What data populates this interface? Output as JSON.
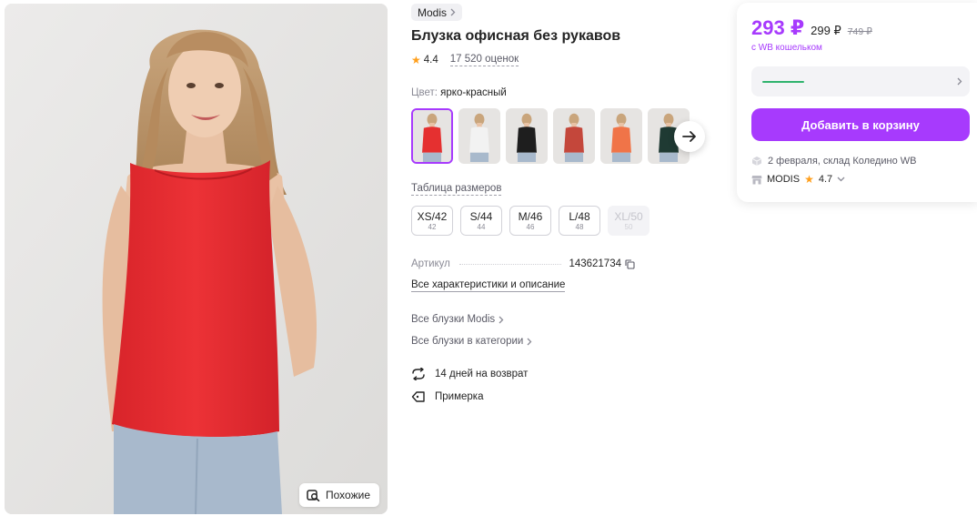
{
  "gallery": {
    "similar_label": "Похожие"
  },
  "product": {
    "brand": "Modis",
    "title": "Блузка офисная без рукавов",
    "rating": "4.4",
    "reviews": "17 520 оценок",
    "color_label": "Цвет:",
    "color_value": "ярко-красный",
    "thumbnails": [
      {
        "color": "#e53030",
        "selected": true
      },
      {
        "color": "#f2f2f2",
        "selected": false
      },
      {
        "color": "#1e1e1e",
        "selected": false
      },
      {
        "color": "#c4473b",
        "selected": false
      },
      {
        "color": "#f07448",
        "selected": false
      },
      {
        "color": "#1f3a33",
        "selected": false
      }
    ],
    "size_table_link": "Таблица размеров",
    "sizes": [
      {
        "label": "XS/42",
        "ru": "42",
        "available": true
      },
      {
        "label": "S/44",
        "ru": "44",
        "available": true
      },
      {
        "label": "M/46",
        "ru": "46",
        "available": true
      },
      {
        "label": "L/48",
        "ru": "48",
        "available": true
      },
      {
        "label": "XL/50",
        "ru": "50",
        "available": false
      }
    ],
    "sku_label": "Артикул",
    "sku_value": "143621734",
    "all_characteristics": "Все характеристики и описание",
    "links": {
      "brand_category": "Все блузки Modis",
      "category": "Все блузки в категории"
    },
    "features": {
      "returns": "14 дней на возврат",
      "fitting": "Примерка"
    }
  },
  "price_card": {
    "price": "293 ₽",
    "price_without_wallet": "299 ₽",
    "old_price": "749 ₽",
    "wallet_note": "с WB кошельком",
    "add_to_cart": "Добавить в корзину",
    "delivery": "2 февраля, склад Коледино WB",
    "seller_name": "MODIS",
    "seller_rating": "4.7"
  },
  "colors": {
    "accent": "#a73afd",
    "star": "#ff9f1c",
    "wallet_bar": "#2fb36d"
  }
}
